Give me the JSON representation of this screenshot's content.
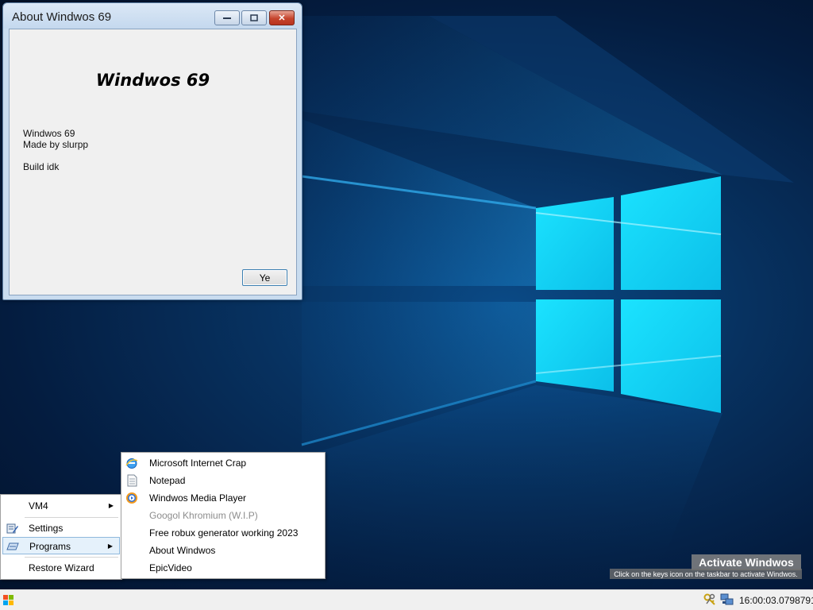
{
  "about_window": {
    "title": "About Windwos 69",
    "heading": "Windwos 69",
    "info_lines": [
      "Windwos 69",
      "Made by slurpp",
      "Build idk"
    ],
    "ok_label": "Ye",
    "close_glyph": "✕"
  },
  "start_menu": {
    "items": [
      {
        "label": "VM4",
        "icon": "none",
        "has_submenu": true
      },
      {
        "label": "Settings",
        "icon": "settings-icon",
        "has_submenu": false
      },
      {
        "label": "Programs",
        "icon": "programs-icon",
        "has_submenu": true,
        "highlighted": true
      },
      {
        "label": "Restore Wizard",
        "icon": "none",
        "has_submenu": false
      }
    ],
    "submenu_arrow": "▶"
  },
  "programs_menu": {
    "items": [
      {
        "label": "Microsoft Internet Crap",
        "icon": "internet-explorer-icon",
        "enabled": true
      },
      {
        "label": "Notepad",
        "icon": "notepad-icon",
        "enabled": true
      },
      {
        "label": "Windwos Media Player",
        "icon": "media-player-icon",
        "enabled": true
      },
      {
        "label": "Googol Khromium (W.I.P)",
        "icon": "none",
        "enabled": false
      },
      {
        "label": "Free robux generator working 2023",
        "icon": "none",
        "enabled": true
      },
      {
        "label": "About Windwos",
        "icon": "none",
        "enabled": true
      },
      {
        "label": "EpicVideo",
        "icon": "none",
        "enabled": true
      }
    ]
  },
  "watermark": {
    "title": "Activate Windwos",
    "subtitle": "Click on the keys icon on the taskbar to activate Windwos."
  },
  "taskbar": {
    "start_icon": "windows-logo-icon",
    "tray_icons": [
      "key-icon",
      "network-icon"
    ],
    "clock": "16:00:03.0798791"
  },
  "colors": {
    "wallpaper_dark": "#041c3f",
    "logo_cyan": "#14d4f4",
    "window_frame": "#c9dcef",
    "close_red": "#c5442c",
    "menu_highlight": "#e5f1fb"
  }
}
